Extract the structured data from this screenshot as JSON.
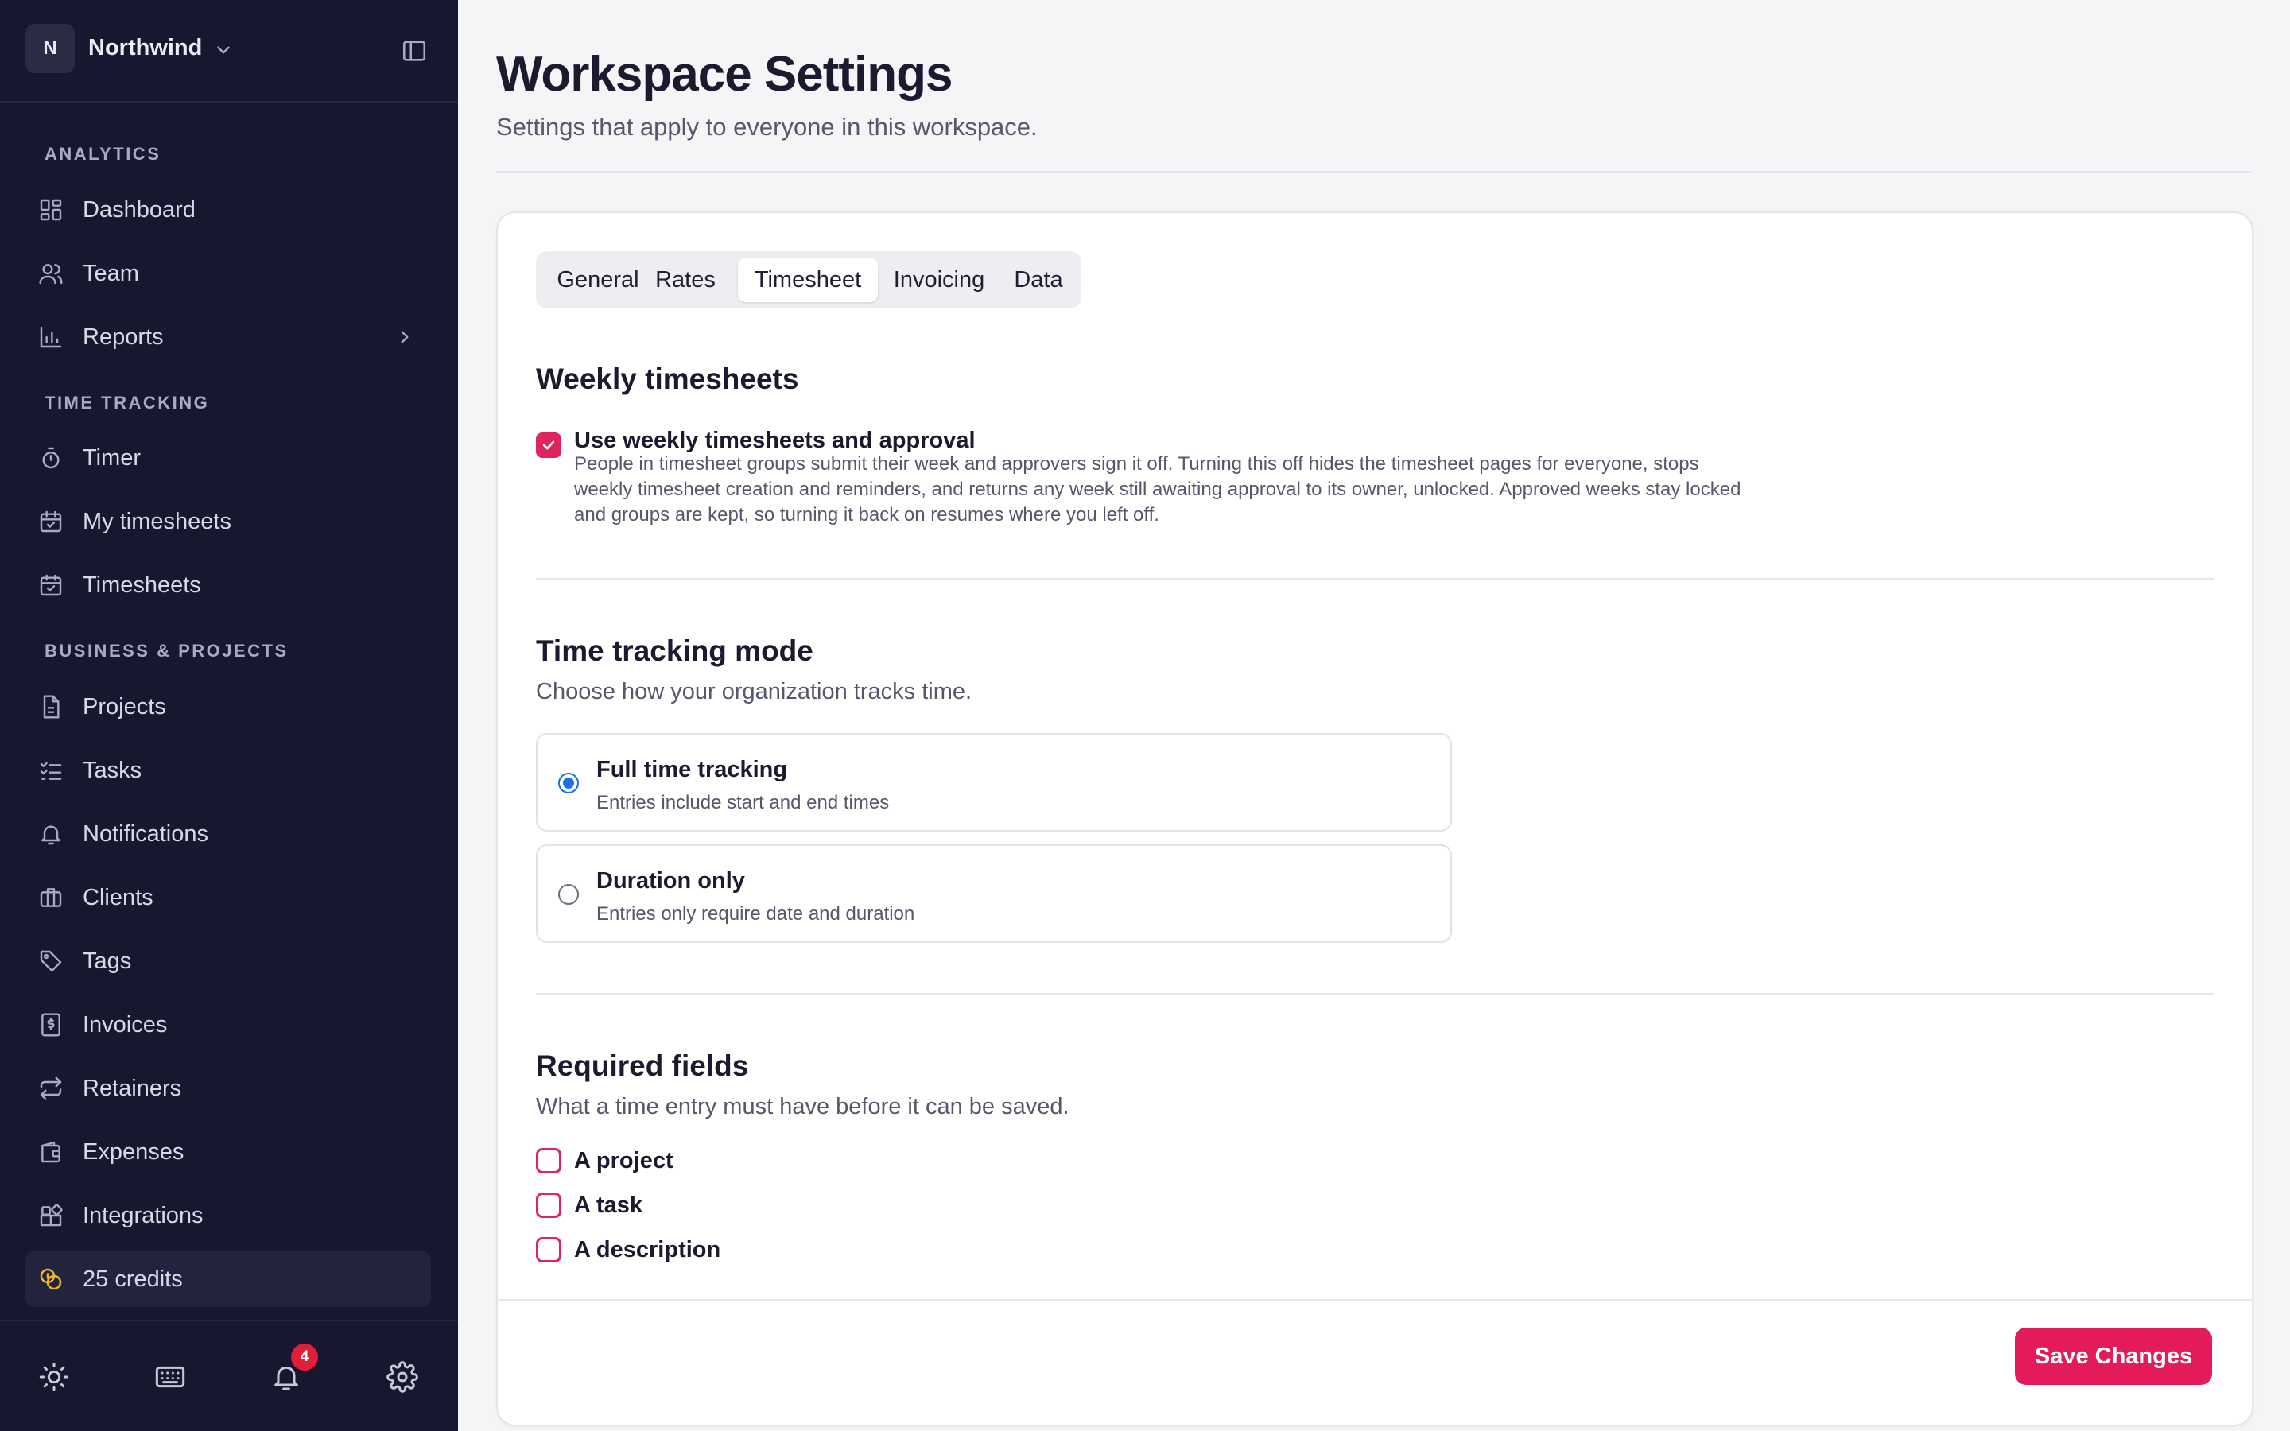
{
  "workspace": {
    "initial": "N",
    "name": "Northwind"
  },
  "sidebar": {
    "sections": [
      {
        "label": "ANALYTICS"
      },
      {
        "label": "TIME TRACKING"
      },
      {
        "label": "BUSINESS & PROJECTS"
      }
    ],
    "items": [
      {
        "label": "Dashboard",
        "icon": "dashboard-icon"
      },
      {
        "label": "Team",
        "icon": "users-icon"
      },
      {
        "label": "Reports",
        "icon": "bar-chart-icon"
      },
      {
        "label": "Timer",
        "icon": "stopwatch-icon"
      },
      {
        "label": "My timesheets",
        "icon": "calendar-check-icon"
      },
      {
        "label": "Timesheets",
        "icon": "calendar-check-icon"
      },
      {
        "label": "Projects",
        "icon": "document-icon"
      },
      {
        "label": "Tasks",
        "icon": "task-list-icon"
      },
      {
        "label": "Notifications",
        "icon": "bell-icon"
      },
      {
        "label": "Clients",
        "icon": "briefcase-icon"
      },
      {
        "label": "Tags",
        "icon": "tag-icon"
      },
      {
        "label": "Invoices",
        "icon": "invoice-icon"
      },
      {
        "label": "Retainers",
        "icon": "repeat-icon"
      },
      {
        "label": "Expenses",
        "icon": "wallet-icon"
      },
      {
        "label": "Integrations",
        "icon": "integrations-icon"
      }
    ],
    "credits": {
      "label": "25 credits",
      "icon": "coins-icon",
      "color": "#f0b429"
    },
    "footer": {
      "notification_count": "4"
    }
  },
  "page": {
    "title": "Workspace Settings",
    "subtitle": "Settings that apply to everyone in this workspace."
  },
  "tabs": [
    {
      "label": "General",
      "active": false
    },
    {
      "label": "Rates",
      "active": false
    },
    {
      "label": "Timesheet",
      "active": true
    },
    {
      "label": "Invoicing",
      "active": false
    },
    {
      "label": "Data",
      "active": false
    }
  ],
  "weekly": {
    "heading": "Weekly timesheets",
    "checkbox_label": "Use weekly timesheets and approval",
    "checked": true,
    "help": "People in timesheet groups submit their week and approvers sign it off. Turning this off hides the timesheet pages for everyone, stops weekly timesheet creation and reminders, and returns any week still awaiting approval to its owner, unlocked. Approved weeks stay locked and groups are kept, so turning it back on resumes where you left off."
  },
  "mode": {
    "heading": "Time tracking mode",
    "description": "Choose how your organization tracks time.",
    "options": [
      {
        "title": "Full time tracking",
        "description": "Entries include start and end times",
        "selected": true
      },
      {
        "title": "Duration only",
        "description": "Entries only require date and duration",
        "selected": false
      }
    ]
  },
  "required": {
    "heading": "Required fields",
    "description": "What a time entry must have before it can be saved.",
    "fields": [
      {
        "label": "A project",
        "checked": false
      },
      {
        "label": "A task",
        "checked": false
      },
      {
        "label": "A description",
        "checked": false
      }
    ]
  },
  "save_label": "Save Changes",
  "colors": {
    "accent": "#e41b5b",
    "radio": "#1d6fe5",
    "sidebar_bg": "#171830"
  }
}
